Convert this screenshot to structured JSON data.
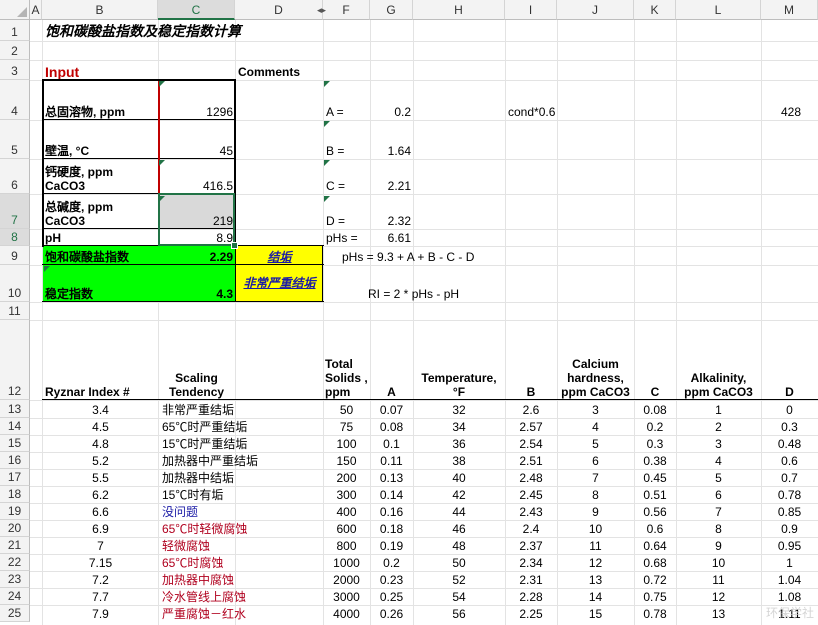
{
  "columns": [
    "A",
    "B",
    "C",
    "D",
    "F",
    "G",
    "H",
    "I",
    "J",
    "K",
    "L",
    "M"
  ],
  "rows": [
    "1",
    "2",
    "3",
    "4",
    "5",
    "6",
    "7",
    "8",
    "9",
    "10",
    "11",
    "12",
    "13",
    "14",
    "15",
    "16",
    "17",
    "18",
    "19",
    "20",
    "21",
    "22",
    "23",
    "24",
    "25"
  ],
  "selected_column": "C",
  "selected_rows": [
    "7",
    "8"
  ],
  "title": "饱和碳酸盐指数及稳定指数计算",
  "input_label": "Input",
  "comments_label": "Comments",
  "inputs": [
    {
      "label": "总固溶物, ppm",
      "value": "1296"
    },
    {
      "label": "壁温, °C",
      "value": "45"
    },
    {
      "label_line1": "钙硬度, ppm",
      "label_line2": "CaCO3",
      "value": "416.5"
    },
    {
      "label_line1": "总碱度, ppm",
      "label_line2": "CaCO3",
      "value": "219"
    },
    {
      "label": "pH",
      "value": "8.9"
    }
  ],
  "results": [
    {
      "label": "饱和碳酸盐指数",
      "value": "2.29",
      "tag": "结垢"
    },
    {
      "label": "稳定指数",
      "value": "4.3",
      "tag": "非常严重结垢"
    }
  ],
  "params": [
    {
      "name": "A =",
      "value": "0.2"
    },
    {
      "name": "B =",
      "value": "1.64"
    },
    {
      "name": "C =",
      "value": "2.21"
    },
    {
      "name": "D =",
      "value": "2.32"
    },
    {
      "name": "pHs =",
      "value": "6.61"
    }
  ],
  "cond_label": "cond*0.6",
  "cond_value": "428",
  "formula_phs": "pHs = 9.3 + A + B - C - D",
  "formula_ri": "RI = 2 * pHs - pH",
  "table_headers": {
    "ryznar": "Ryznar Index #",
    "scaling": "Scaling Tendency",
    "solids": "Total Solids , ppm",
    "a": "A",
    "temp": "Temperature, °F",
    "b": "B",
    "calcium": "Calcium hardness, ppm CaCO3",
    "c": "C",
    "alk": "Alkalinity, ppm CaCO3",
    "d": "D"
  },
  "table_rows": [
    {
      "ri": "3.4",
      "tend": "非常严重结垢",
      "tone": "normal",
      "sol": "50",
      "a": "0.07",
      "temp": "32",
      "b": "2.6",
      "ca": "3",
      "c": "0.08",
      "alk": "1",
      "d": "0"
    },
    {
      "ri": "4.5",
      "tend": "65℃时严重结垢",
      "tone": "normal",
      "sol": "75",
      "a": "0.08",
      "temp": "34",
      "b": "2.57",
      "ca": "4",
      "c": "0.2",
      "alk": "2",
      "d": "0.3"
    },
    {
      "ri": "4.8",
      "tend": "15℃时严重结垢",
      "tone": "normal",
      "sol": "100",
      "a": "0.1",
      "temp": "36",
      "b": "2.54",
      "ca": "5",
      "c": "0.3",
      "alk": "3",
      "d": "0.48"
    },
    {
      "ri": "5.2",
      "tend": "加热器中严重结垢",
      "tone": "normal",
      "sol": "150",
      "a": "0.11",
      "temp": "38",
      "b": "2.51",
      "ca": "6",
      "c": "0.38",
      "alk": "4",
      "d": "0.6"
    },
    {
      "ri": "5.5",
      "tend": "加热器中结垢",
      "tone": "normal",
      "sol": "200",
      "a": "0.13",
      "temp": "40",
      "b": "2.48",
      "ca": "7",
      "c": "0.45",
      "alk": "5",
      "d": "0.7"
    },
    {
      "ri": "6.2",
      "tend": "15℃时有垢",
      "tone": "normal",
      "sol": "300",
      "a": "0.14",
      "temp": "42",
      "b": "2.45",
      "ca": "8",
      "c": "0.51",
      "alk": "6",
      "d": "0.78"
    },
    {
      "ri": "6.6",
      "tend": "没问题",
      "tone": "blue",
      "sol": "400",
      "a": "0.16",
      "temp": "44",
      "b": "2.43",
      "ca": "9",
      "c": "0.56",
      "alk": "7",
      "d": "0.85"
    },
    {
      "ri": "6.9",
      "tend": "65℃时轻微腐蚀",
      "tone": "red",
      "sol": "600",
      "a": "0.18",
      "temp": "46",
      "b": "2.4",
      "ca": "10",
      "c": "0.6",
      "alk": "8",
      "d": "0.9"
    },
    {
      "ri": "7",
      "tend": "轻微腐蚀",
      "tone": "red",
      "sol": "800",
      "a": "0.19",
      "temp": "48",
      "b": "2.37",
      "ca": "11",
      "c": "0.64",
      "alk": "9",
      "d": "0.95"
    },
    {
      "ri": "7.15",
      "tend": "65℃时腐蚀",
      "tone": "red",
      "sol": "1000",
      "a": "0.2",
      "temp": "50",
      "b": "2.34",
      "ca": "12",
      "c": "0.68",
      "alk": "10",
      "d": "1"
    },
    {
      "ri": "7.2",
      "tend": "加热器中腐蚀",
      "tone": "red",
      "sol": "2000",
      "a": "0.23",
      "temp": "52",
      "b": "2.31",
      "ca": "13",
      "c": "0.72",
      "alk": "11",
      "d": "1.04"
    },
    {
      "ri": "7.7",
      "tend": "冷水管线上腐蚀",
      "tone": "red",
      "sol": "3000",
      "a": "0.25",
      "temp": "54",
      "b": "2.28",
      "ca": "14",
      "c": "0.75",
      "alk": "12",
      "d": "1.08"
    },
    {
      "ri": "7.9",
      "tend": "严重腐蚀－红水",
      "tone": "red",
      "sol": "4000",
      "a": "0.26",
      "temp": "56",
      "b": "2.25",
      "ca": "15",
      "c": "0.78",
      "alk": "13",
      "d": "1.11"
    }
  ],
  "watermark": "环保学社"
}
